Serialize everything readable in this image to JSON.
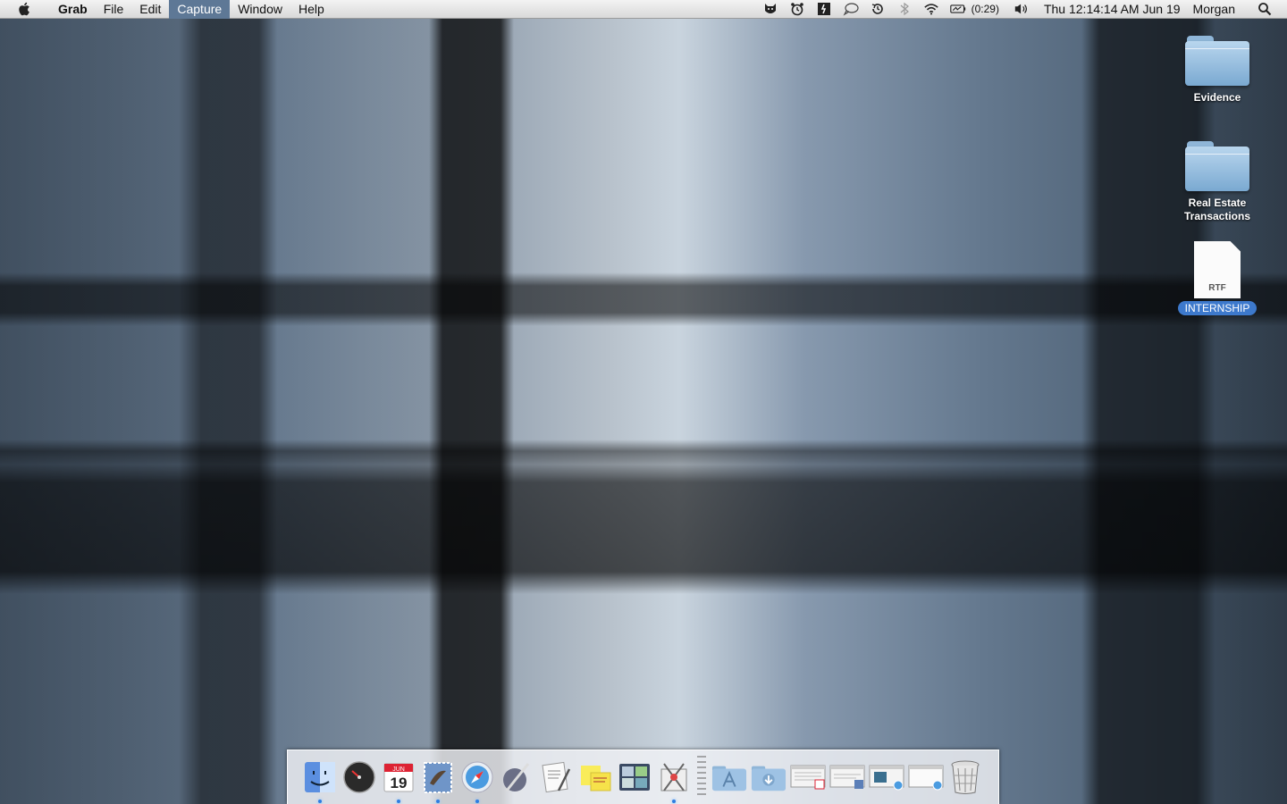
{
  "menubar": {
    "apple_icon": "apple-icon",
    "items": [
      {
        "label": "Grab",
        "bold": true
      },
      {
        "label": "File"
      },
      {
        "label": "Edit"
      },
      {
        "label": "Capture",
        "active": true
      },
      {
        "label": "Window"
      },
      {
        "label": "Help"
      }
    ],
    "status_icons": [
      "growl-icon",
      "alarm-clock-icon",
      "timer-icon",
      "chat-bubble-icon",
      "time-machine-icon",
      "bluetooth-icon",
      "wifi-icon",
      "battery-icon"
    ],
    "battery_text": "(0:29)",
    "volume_icon": "volume-icon",
    "clock": "Thu 12:14:14 AM  Jun 19",
    "user": "Morgan",
    "spotlight_icon": "spotlight-search-icon"
  },
  "desktop": {
    "icons": [
      {
        "name": "Evidence",
        "type": "folder"
      },
      {
        "name": "Real Estate Transactions",
        "type": "folder"
      },
      {
        "name": "INTERNSHIP",
        "type": "document",
        "ext": "RTF",
        "selected": true
      }
    ]
  },
  "dock": {
    "calendar_month": "JUN",
    "calendar_day": "19",
    "items": [
      {
        "name": "finder-icon",
        "running": true
      },
      {
        "name": "dashboard-icon",
        "running": false
      },
      {
        "name": "ical-icon",
        "running": true
      },
      {
        "name": "mail-icon",
        "running": true
      },
      {
        "name": "safari-icon",
        "running": true
      },
      {
        "name": "script-editor-icon",
        "running": false
      },
      {
        "name": "textedit-icon",
        "running": false
      },
      {
        "name": "stickies-icon",
        "running": false
      },
      {
        "name": "expose-spaces-icon",
        "running": false
      },
      {
        "name": "grab-icon",
        "running": true
      },
      {
        "name": "applications-stack-icon",
        "running": false
      },
      {
        "name": "downloads-stack-icon",
        "running": false
      },
      {
        "name": "minimized-window-ical-icon",
        "running": false
      },
      {
        "name": "minimized-window-preview-icon",
        "running": false
      },
      {
        "name": "minimized-window-safari-1-icon",
        "running": false
      },
      {
        "name": "minimized-window-safari-2-icon",
        "running": false
      },
      {
        "name": "trash-icon",
        "running": false
      }
    ]
  }
}
